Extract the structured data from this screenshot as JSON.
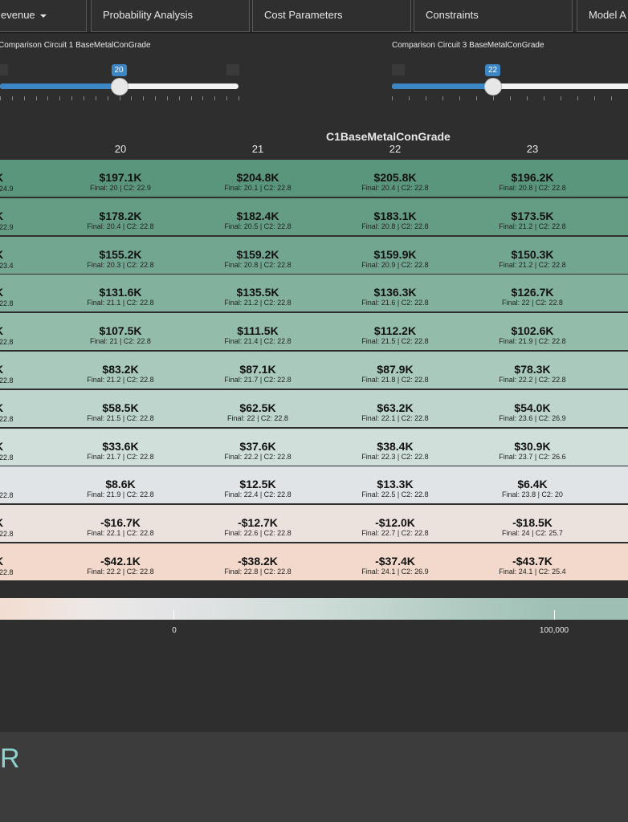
{
  "nav": {
    "tabs": [
      {
        "id": "tab-revenue",
        "label": "evenue",
        "dropdown": true
      },
      {
        "id": "tab-prob",
        "label": "Probability Analysis"
      },
      {
        "id": "tab-cost",
        "label": "Cost Parameters"
      },
      {
        "id": "tab-cons",
        "label": "Constraints"
      },
      {
        "id": "tab-model",
        "label": "Model A"
      }
    ]
  },
  "sliders": {
    "circuit1": {
      "label": "Comparison Circuit 1 BaseMetalConGrade",
      "value": "20",
      "value_num": 20,
      "min": 10,
      "max": 30
    },
    "circuit3": {
      "label": "Comparison Circuit 3 BaseMetalConGrade",
      "value": "22",
      "value_num": 22,
      "min": 16,
      "max": 30
    }
  },
  "heatmap": {
    "x_axis_title": "C1BaseMetalConGrade",
    "columns": [
      "20",
      "21",
      "22",
      "23"
    ],
    "left_partial": [
      {
        "v": "K",
        "s": ": 24.9"
      },
      {
        "v": "K",
        "s": ": 22.9"
      },
      {
        "v": "K",
        "s": ": 23.4"
      },
      {
        "v": "K",
        "s": ": 22.8"
      },
      {
        "v": "K",
        "s": ": 22.8"
      },
      {
        "v": "K",
        "s": ": 22.8"
      },
      {
        "v": "K",
        "s": ": 22.8"
      },
      {
        "v": "K",
        "s": ": 22.8"
      },
      {
        "v": "",
        "s": ": 22.8"
      },
      {
        "v": "K",
        "s": ": 22.8"
      },
      {
        "v": "K",
        "s": ": 22.8"
      }
    ],
    "rows": [
      {
        "color": "#5a967c",
        "cells": [
          {
            "v": "$197.1K",
            "s": "Final: 20 | C2: 22.9"
          },
          {
            "v": "$204.8K",
            "s": "Final: 20.1 | C2: 22.8"
          },
          {
            "v": "$205.8K",
            "s": "Final: 20.4 | C2: 22.8"
          },
          {
            "v": "$196.2K",
            "s": "Final: 20.8 | C2: 22.8"
          }
        ]
      },
      {
        "color": "#649d84",
        "cells": [
          {
            "v": "$178.2K",
            "s": "Final: 20.4 | C2: 22.8"
          },
          {
            "v": "$182.4K",
            "s": "Final: 20.5 | C2: 22.8"
          },
          {
            "v": "$183.1K",
            "s": "Final: 20.8 | C2: 22.8"
          },
          {
            "v": "$173.5K",
            "s": "Final: 21.2 | C2: 22.8"
          }
        ]
      },
      {
        "color": "#72a690",
        "cells": [
          {
            "v": "$155.2K",
            "s": "Final: 20.3 | C2: 22.8"
          },
          {
            "v": "$159.2K",
            "s": "Final: 20.8 | C2: 22.8"
          },
          {
            "v": "$159.9K",
            "s": "Final: 20.9 | C2: 22.8"
          },
          {
            "v": "$150.3K",
            "s": "Final: 21.2 | C2: 22.8"
          }
        ]
      },
      {
        "color": "#82b19d",
        "cells": [
          {
            "v": "$131.6K",
            "s": "Final: 21.1 | C2: 22.8"
          },
          {
            "v": "$135.5K",
            "s": "Final: 21.2 | C2: 22.8"
          },
          {
            "v": "$136.3K",
            "s": "Final: 21.6 | C2: 22.8"
          },
          {
            "v": "$126.7K",
            "s": "Final: 22 | C2: 22.8"
          }
        ]
      },
      {
        "color": "#93bcaa",
        "cells": [
          {
            "v": "$107.5K",
            "s": "Final: 21 | C2: 22.8"
          },
          {
            "v": "$111.5K",
            "s": "Final: 21.4 | C2: 22.8"
          },
          {
            "v": "$112.2K",
            "s": "Final: 21.5 | C2: 22.8"
          },
          {
            "v": "$102.6K",
            "s": "Final: 21.9 | C2: 22.8"
          }
        ]
      },
      {
        "color": "#a8c9bc",
        "cells": [
          {
            "v": "$83.2K",
            "s": "Final: 21.2 | C2: 22.8"
          },
          {
            "v": "$87.1K",
            "s": "Final: 21.7 | C2: 22.8"
          },
          {
            "v": "$87.9K",
            "s": "Final: 21.8 | C2: 22.8"
          },
          {
            "v": "$78.3K",
            "s": "Final: 22.2 | C2: 22.8"
          }
        ]
      },
      {
        "color": "#bdd5cc",
        "cells": [
          {
            "v": "$58.5K",
            "s": "Final: 21.5 | C2: 22.8"
          },
          {
            "v": "$62.5K",
            "s": "Final: 22 | C2: 22.8"
          },
          {
            "v": "$63.2K",
            "s": "Final: 22.1 | C2: 22.8"
          },
          {
            "v": "$54.0K",
            "s": "Final: 23.6 | C2: 26.9"
          }
        ]
      },
      {
        "color": "#d0dfda",
        "cells": [
          {
            "v": "$33.6K",
            "s": "Final: 21.7 | C2: 22.8"
          },
          {
            "v": "$37.6K",
            "s": "Final: 22.2 | C2: 22.8"
          },
          {
            "v": "$38.4K",
            "s": "Final: 22.3 | C2: 22.8"
          },
          {
            "v": "$30.9K",
            "s": "Final: 23.7 | C2: 26.6"
          }
        ]
      },
      {
        "color": "#e1e4e6",
        "cells": [
          {
            "v": "$8.6K",
            "s": "Final: 21.9 | C2: 22.8"
          },
          {
            "v": "$12.5K",
            "s": "Final: 22.4 | C2: 22.8"
          },
          {
            "v": "$13.3K",
            "s": "Final: 22.5 | C2: 22.8"
          },
          {
            "v": "$6.4K",
            "s": "Final: 23.8 | C2: 20"
          }
        ]
      },
      {
        "color": "#ebe2de",
        "cells": [
          {
            "v": "-$16.7K",
            "s": "Final: 22.1 | C2: 22.8"
          },
          {
            "v": "-$12.7K",
            "s": "Final: 22.6 | C2: 22.8"
          },
          {
            "v": "-$12.0K",
            "s": "Final: 22.7 | C2: 22.8"
          },
          {
            "v": "-$18.5K",
            "s": "Final: 24 | C2: 25.7"
          }
        ]
      },
      {
        "color": "#f2d9cb",
        "cells": [
          {
            "v": "-$42.1K",
            "s": "Final: 22.2 | C2: 22.8"
          },
          {
            "v": "-$38.2K",
            "s": "Final: 22.8 | C2: 22.8"
          },
          {
            "v": "-$37.4K",
            "s": "Final: 24.1 | C2: 26.9"
          },
          {
            "v": "-$43.7K",
            "s": "Final: 24.1 | C2: 25.4"
          }
        ]
      }
    ]
  },
  "legend": {
    "labels": [
      "0",
      "100,000"
    ]
  },
  "footer": {
    "logo_text": "R"
  }
}
